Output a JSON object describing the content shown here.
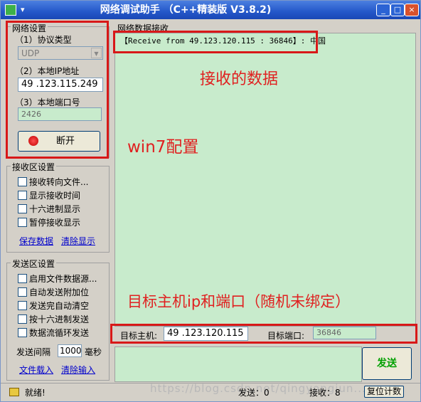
{
  "window": {
    "title": "网络调试助手 （C++精装版 V3.8.2)",
    "minimize": "_",
    "restore": "□",
    "close": "×"
  },
  "network": {
    "legend": "网络设置",
    "protocol_label": "（1）协议类型",
    "protocol_value": "UDP",
    "ip_label": "（2）本地IP地址",
    "ip_value": "49 .123.115.249",
    "port_label": "（3）本地端口号",
    "port_value": "2426",
    "disconnect_label": "断开"
  },
  "recv_settings": {
    "legend": "接收区设置",
    "options": [
      "接收转向文件...",
      "显示接收时间",
      "十六进制显示",
      "暂停接收显示"
    ],
    "save_label": "保存数据",
    "clear_label": "清除显示"
  },
  "send_settings": {
    "legend": "发送区设置",
    "options": [
      "启用文件数据源...",
      "自动发送附加位",
      "发送完自动清空",
      "按十六进制发送",
      "数据流循环发送"
    ],
    "interval_label": "发送间隔",
    "interval_value": "1000",
    "interval_unit": "毫秒",
    "load_file_label": "文件载入",
    "clear_input_label": "清除输入"
  },
  "receive": {
    "legend": "网络数据接收",
    "line": "【Receive from 49.123.120.115 : 36846】: 中国"
  },
  "target": {
    "host_label": "目标主机:",
    "host_value": "49 .123.120.115",
    "port_label": "目标端口:",
    "port_value": "36846"
  },
  "send_button": "发送",
  "statusbar": {
    "ready": "就绪!",
    "send_label": "发送：0",
    "recv_label": "接收：8",
    "reset_label": "复位计数"
  },
  "annotations": {
    "received_data": "接收的数据",
    "win7_config": "win7配置",
    "target_info": "目标主机ip和端口（随机未绑定）"
  },
  "watermark": "https://blog.csdn.net/qingyongjun..."
}
